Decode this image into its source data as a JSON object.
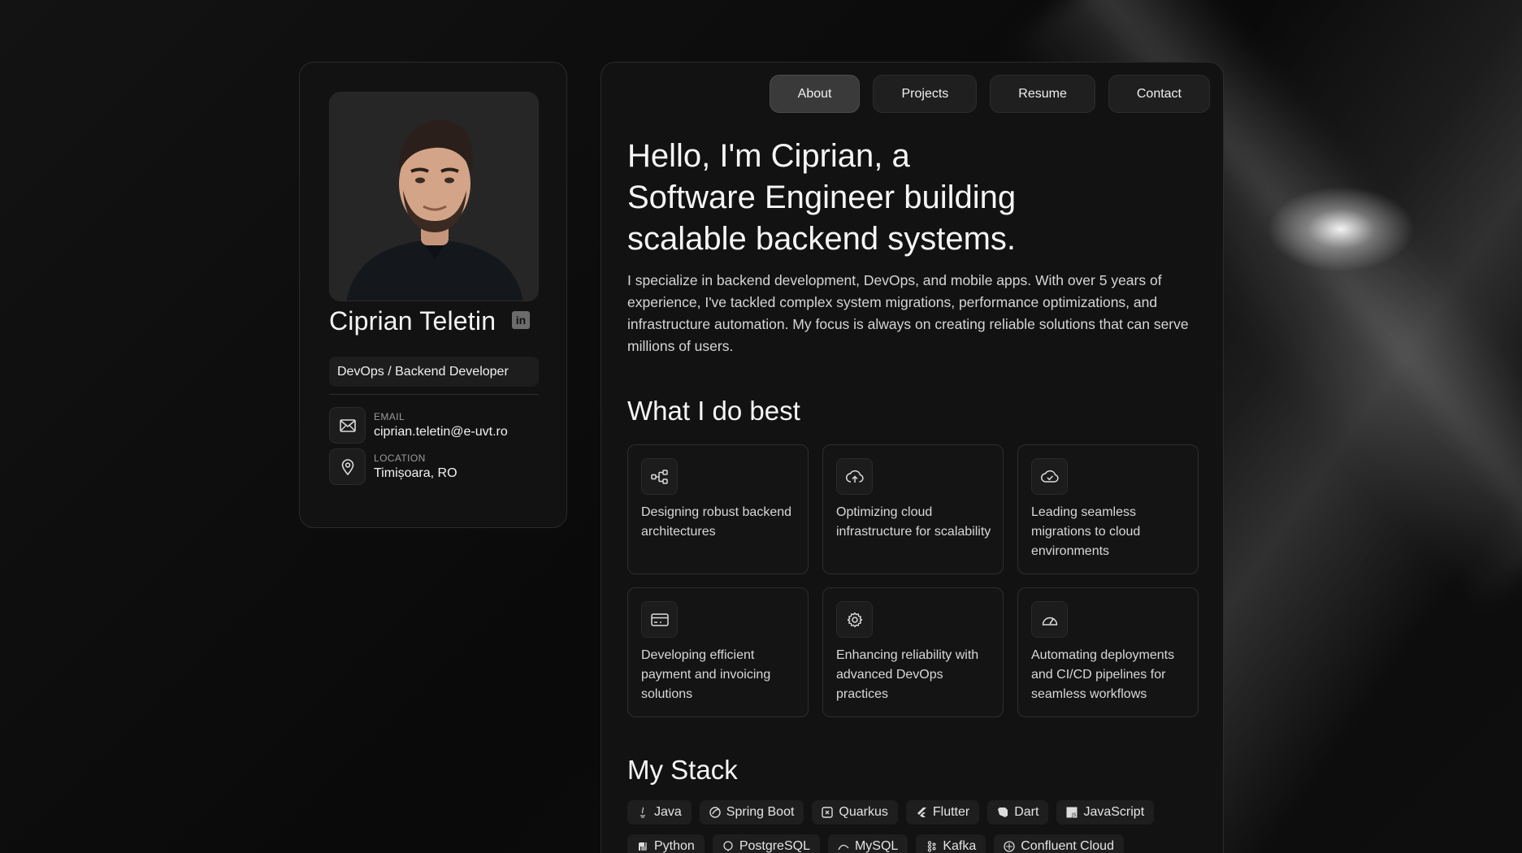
{
  "profile": {
    "name": "Ciprian Teletin",
    "role": "DevOps / Backend Developer",
    "linkedin_icon": "in",
    "email_label": "EMAIL",
    "email": "ciprian.teletin@e-uvt.ro",
    "location_label": "LOCATION",
    "location": "Timișoara, RO"
  },
  "nav": {
    "items": [
      {
        "label": "About"
      },
      {
        "label": "Projects"
      },
      {
        "label": "Resume"
      },
      {
        "label": "Contact"
      }
    ],
    "active": "About"
  },
  "hero": {
    "title_line1": "Hello, I'm Ciprian, a",
    "title_line2": "Software Engineer building",
    "title_line3": "scalable backend systems.",
    "text": "I specialize in backend development, DevOps, and mobile apps. With over 5 years of experience, I've tackled complex system migrations, performance optimizations, and infrastructure automation. My focus is always on creating reliable solutions that can serve millions of users."
  },
  "skills": {
    "title": "What I do best",
    "items": [
      {
        "icon": "architecture-icon",
        "text": "Designing robust backend architectures"
      },
      {
        "icon": "cloud-upload-icon",
        "text": "Optimizing cloud infrastructure for scalability"
      },
      {
        "icon": "cloud-check-icon",
        "text": "Leading seamless migrations to cloud environments"
      },
      {
        "icon": "credit-card-icon",
        "text": "Developing efficient payment and invoicing solutions"
      },
      {
        "icon": "gear-icon",
        "text": "Enhancing reliability with advanced DevOps practices"
      },
      {
        "icon": "gauge-icon",
        "text": "Automating deployments and CI/CD pipelines for seamless workflows"
      }
    ]
  },
  "stack": {
    "title": "My Stack",
    "items": [
      {
        "label": "Java",
        "icon": "java-icon"
      },
      {
        "label": "Spring Boot",
        "icon": "spring-icon"
      },
      {
        "label": "Quarkus",
        "icon": "quarkus-icon"
      },
      {
        "label": "Flutter",
        "icon": "flutter-icon"
      },
      {
        "label": "Dart",
        "icon": "dart-icon"
      },
      {
        "label": "JavaScript",
        "icon": "javascript-icon"
      },
      {
        "label": "Python",
        "icon": "python-icon"
      },
      {
        "label": "PostgreSQL",
        "icon": "postgresql-icon"
      },
      {
        "label": "MySQL",
        "icon": "mysql-icon"
      },
      {
        "label": "Kafka",
        "icon": "kafka-icon"
      },
      {
        "label": "Confluent Cloud",
        "icon": "confluent-icon"
      }
    ]
  },
  "colors": {
    "background": "#0b0b0b",
    "card": "#121212",
    "active_nav": "#3a3a3a"
  }
}
